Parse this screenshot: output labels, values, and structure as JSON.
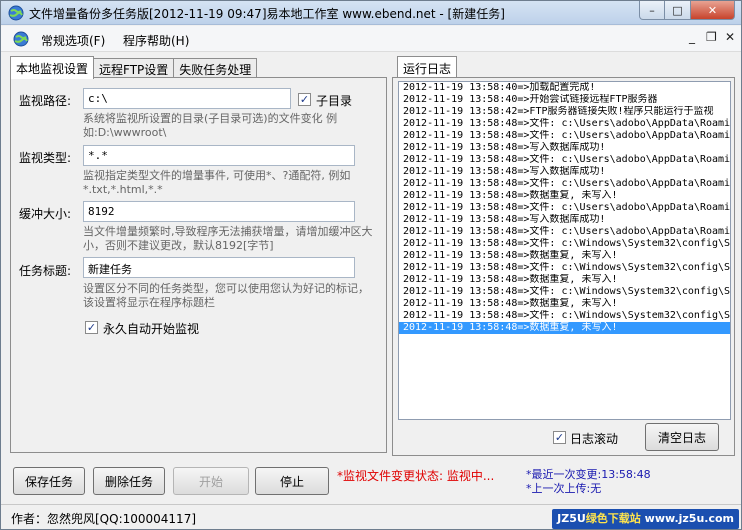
{
  "window": {
    "title": "文件增量备份多任务版[2012-11-19 09:47]易本地工作室 www.ebend.net - [新建任务]",
    "controls": {
      "minimize": "–",
      "maximize": "□",
      "close": "✕"
    }
  },
  "menu": {
    "items": [
      "常规选项(F)",
      "程序帮助(H)"
    ],
    "mdi_controls": [
      "_",
      "❐",
      "✕"
    ]
  },
  "tabs": [
    "本地监视设置",
    "远程FTP设置",
    "失败任务处理"
  ],
  "form": {
    "path": {
      "label": "监视路径:",
      "value": "c:\\",
      "subdir_label": "子目录",
      "subdir_checked": true,
      "hint": "系统将监视所设置的目录(子目录可选)的文件变化 例如:D:\\wwwroot\\"
    },
    "type": {
      "label": "监视类型:",
      "value": "*.*",
      "hint": "监视指定类型文件的增量事件, 可使用*、?通配符, 例如*.txt,*.html,*.*"
    },
    "buffer": {
      "label": "缓冲大小:",
      "value": "8192",
      "hint": "当文件增量频繁时,导致程序无法捕获增量，请增加缓冲区大小，否则不建议更改，默认8192[字节]"
    },
    "task": {
      "label": "任务标题:",
      "value": "新建任务",
      "hint": "设置区分不同的任务类型，您可以使用您认为好记的标记，该设置将显示在程序标题栏"
    },
    "autostart": {
      "label": "永久自动开始监视",
      "checked": true
    }
  },
  "log": {
    "tab_label": "运行日志",
    "lines": [
      "2012-11-19 13:58:40=>加载配置完成!",
      "2012-11-19 13:58:40=>开始尝试链接远程FTP服务器",
      "2012-11-19 13:58:42=>FTP服务器链接失败!程序只能运行于监视",
      "2012-11-19 13:58:48=>文件: c:\\Users\\adobo\\AppData\\Roamin",
      "2012-11-19 13:58:48=>文件: c:\\Users\\adobo\\AppData\\Roamin",
      "2012-11-19 13:58:48=>写入数据库成功!",
      "2012-11-19 13:58:48=>文件: c:\\Users\\adobo\\AppData\\Roamin",
      "2012-11-19 13:58:48=>写入数据库成功!",
      "2012-11-19 13:58:48=>文件: c:\\Users\\adobo\\AppData\\Roamin",
      "2012-11-19 13:58:48=>数据重复, 未写入!",
      "2012-11-19 13:58:48=>文件: c:\\Users\\adobo\\AppData\\Roamin",
      "2012-11-19 13:58:48=>写入数据库成功!",
      "2012-11-19 13:58:48=>文件: c:\\Users\\adobo\\AppData\\Roamin",
      "2012-11-19 13:58:48=>文件: c:\\Windows\\System32\\config\\SY",
      "2012-11-19 13:58:48=>数据重复, 未写入!",
      "2012-11-19 13:58:48=>文件: c:\\Windows\\System32\\config\\SY",
      "2012-11-19 13:58:48=>数据重复, 未写入!",
      "2012-11-19 13:58:48=>文件: c:\\Windows\\System32\\config\\SY",
      "2012-11-19 13:58:48=>数据重复, 未写入!",
      "2012-11-19 13:58:48=>文件: c:\\Windows\\System32\\config\\SY",
      "2012-11-19 13:58:48=>数据重复, 未写入!"
    ],
    "selected_index": 20,
    "scroll_label": "日志滚动",
    "scroll_checked": true,
    "clear_button": "清空日志"
  },
  "buttons": {
    "save": "保存任务",
    "delete": "删除任务",
    "start": "开始",
    "stop": "停止"
  },
  "status": {
    "monitor": "*监视文件变更状态: 监视中...",
    "last_change": "*最近一次变更:13:58:48",
    "last_upload": "*上一次上传:无"
  },
  "footer": {
    "author": "作者：忽然兜风[QQ:100004117]",
    "watermark_a": "JZ5U",
    "watermark_b": "绿色下载站",
    "watermark_c": "www.jz5u.com"
  },
  "colors": {
    "status_red": "#e00000",
    "status_blue": "#1a1ab0",
    "selection": "#3399ff"
  }
}
